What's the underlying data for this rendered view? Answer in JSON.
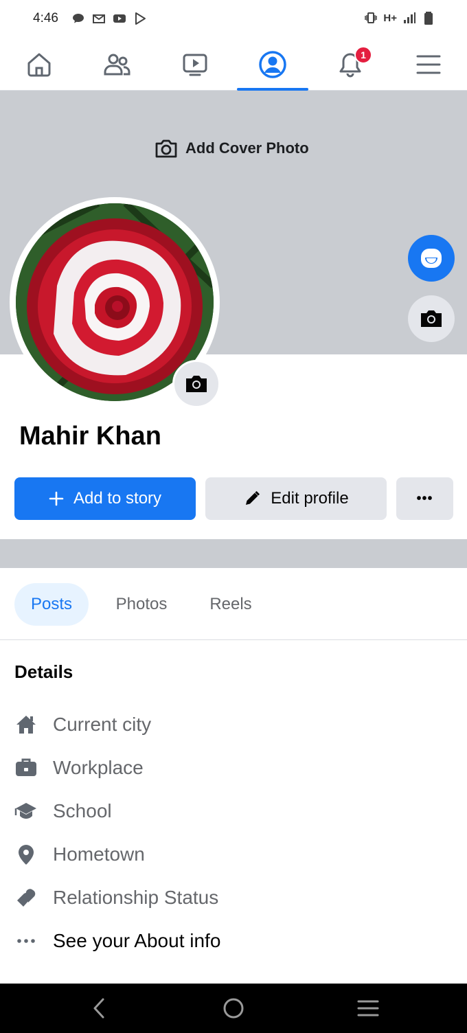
{
  "status_bar": {
    "time": "4:46",
    "network": "H+"
  },
  "nav": {
    "notifications_count": "1",
    "active_tab": "profile"
  },
  "cover": {
    "add_cover_label": "Add Cover Photo"
  },
  "profile": {
    "name": "Mahir Khan"
  },
  "actions": {
    "add_story_label": "Add to story",
    "edit_profile_label": "Edit profile",
    "more_label": "•••"
  },
  "tabs": [
    {
      "label": "Posts",
      "active": true
    },
    {
      "label": "Photos",
      "active": false
    },
    {
      "label": "Reels",
      "active": false
    }
  ],
  "details": {
    "title": "Details",
    "items": [
      {
        "icon": "house-icon",
        "label": "Current city"
      },
      {
        "icon": "briefcase-icon",
        "label": "Workplace"
      },
      {
        "icon": "graduation-cap-icon",
        "label": "School"
      },
      {
        "icon": "location-pin-icon",
        "label": "Hometown"
      },
      {
        "icon": "heart-icon",
        "label": "Relationship Status"
      },
      {
        "icon": "more-dots-icon",
        "label": "See your About info"
      }
    ]
  },
  "colors": {
    "brand_blue": "#1877f2",
    "badge_red": "#e41e3f",
    "cover_gray": "#c9ccd1",
    "button_gray": "#e4e6eb",
    "muted_text": "#65676b"
  }
}
